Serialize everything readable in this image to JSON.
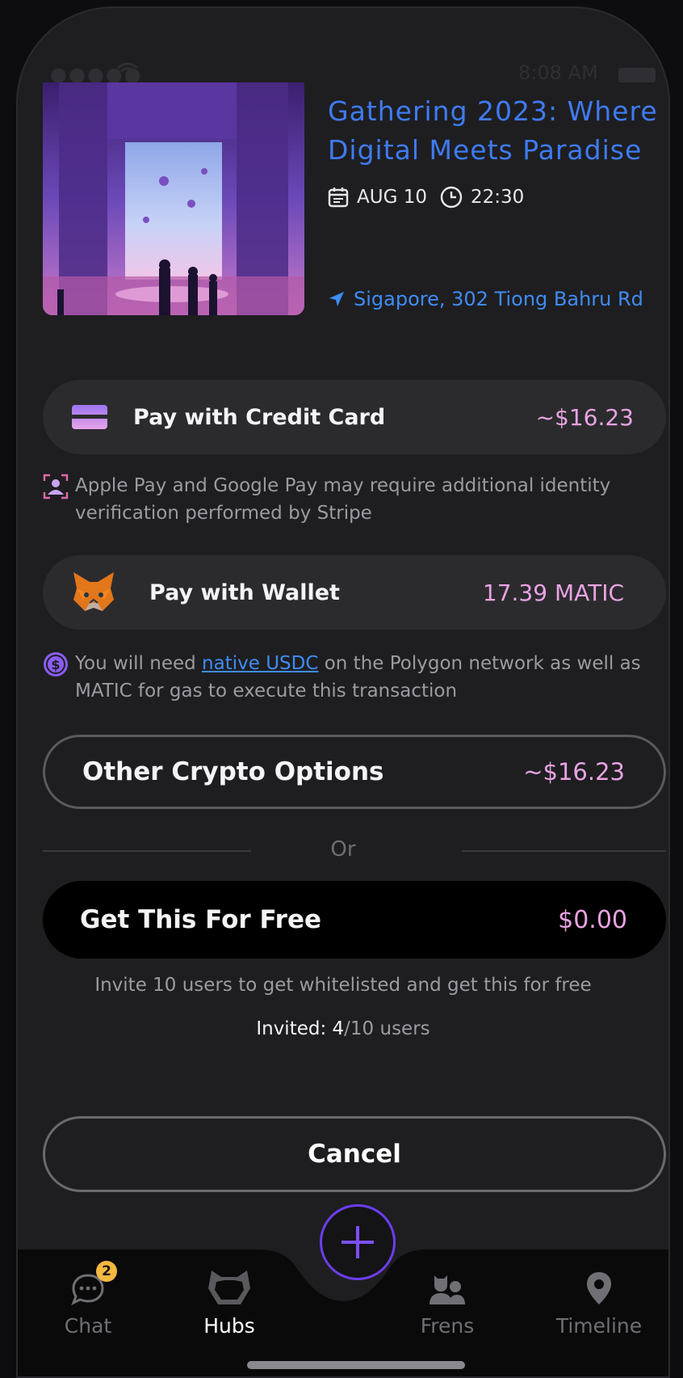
{
  "status_bar": {
    "time": "8:08 AM",
    "signal": "●●●●●"
  },
  "event": {
    "title": "Gathering 2023: Where Digital Meets Paradise",
    "date": "AUG 10",
    "time": "22:30",
    "location": "Sigapore, 302 Tiong Bahru Rd"
  },
  "payments": {
    "credit_card": {
      "label": "Pay with Credit Card",
      "price": "~$16.23"
    },
    "card_note": "Apple Pay and Google Pay may require additional identity verification performed by Stripe",
    "wallet": {
      "label": "Pay with Wallet",
      "price": "17.39 MATIC"
    },
    "wallet_note": {
      "prefix": "You will need ",
      "link": "native USDC",
      "suffix": " on the Polygon network as well as MATIC for gas to execute this transaction"
    },
    "other_crypto": {
      "label": "Other Crypto Options",
      "price": "~$16.23"
    },
    "divider": "Or",
    "free": {
      "label": "Get This For Free",
      "price": "$0.00"
    },
    "invite_note": "Invite 10 users to get whitelisted and get this for free",
    "invited_label": "Invited: ",
    "invited_count": "4",
    "invited_total": "/10 users",
    "cancel": "Cancel"
  },
  "tabbar": {
    "chat": {
      "label": "Chat",
      "badge": "2"
    },
    "hubs": {
      "label": "Hubs"
    },
    "frens": {
      "label": "Frens"
    },
    "timeline": {
      "label": "Timeline"
    }
  },
  "colors": {
    "accent_blue": "#3f7bf3",
    "price_pink": "#e9a3e2",
    "add_button_ring": "#6d3df0",
    "badge": "#f5b941"
  }
}
